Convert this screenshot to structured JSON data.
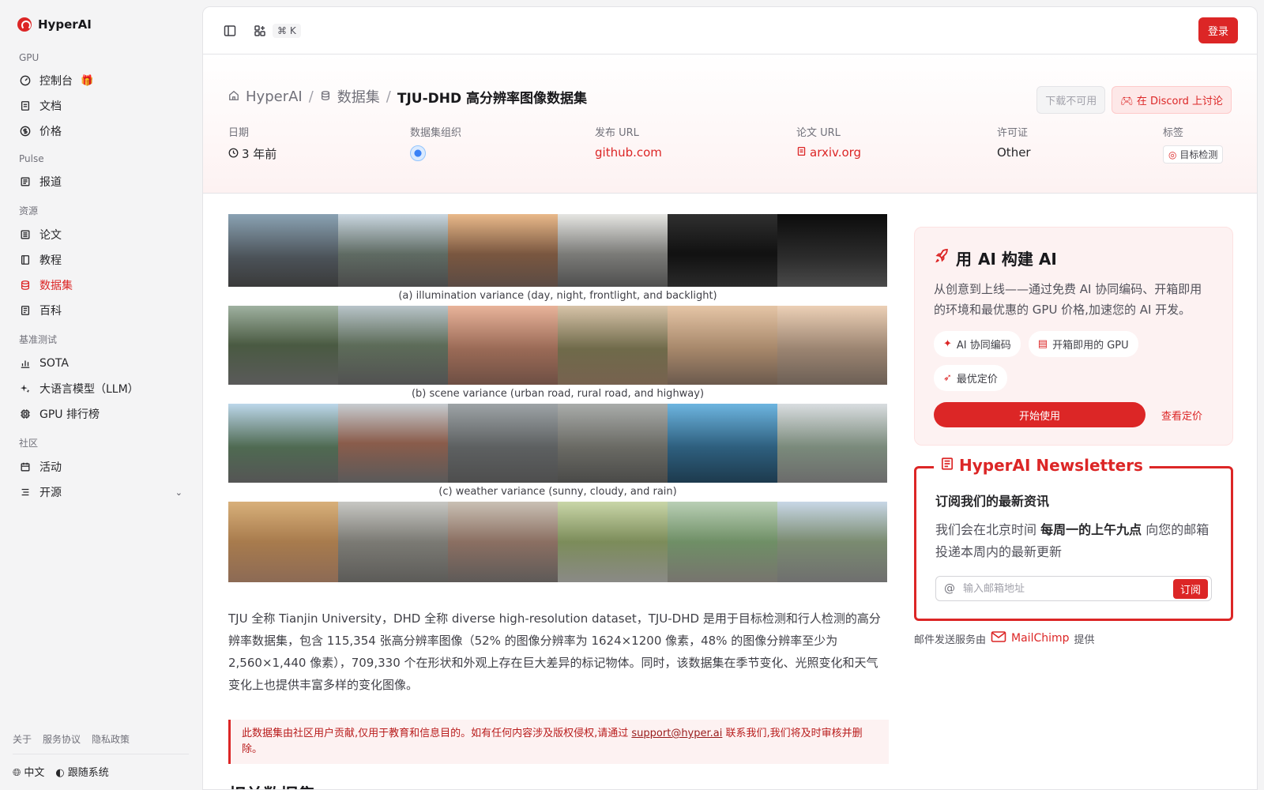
{
  "brand": {
    "name": "HyperAI"
  },
  "sidebar": {
    "sections": {
      "gpu": "GPU",
      "pulse": "Pulse",
      "resources": "资源",
      "benchmark": "基准测试",
      "community": "社区"
    },
    "items": {
      "console": "控制台",
      "docs": "文档",
      "pricing": "价格",
      "news": "报道",
      "papers": "论文",
      "tutorials": "教程",
      "datasets": "数据集",
      "wiki": "百科",
      "sota": "SOTA",
      "llm": "大语言模型（LLM）",
      "gpu_rank": "GPU 排行榜",
      "events": "活动",
      "opensource": "开源"
    },
    "active": "datasets",
    "footer": {
      "about": "关于",
      "terms": "服务协议",
      "privacy": "隐私政策",
      "language": "中文",
      "theme": "跟随系统"
    }
  },
  "topbar": {
    "shortcut": "⌘ K",
    "login": "登录"
  },
  "header": {
    "breadcrumb": {
      "home": "HyperAI",
      "section": "数据集",
      "current": "TJU-DHD 高分辨率图像数据集"
    },
    "download_label": "下载不可用",
    "discord_label": "在 Discord 上讨论",
    "meta": {
      "date_label": "日期",
      "date_value": "3 年前",
      "org_label": "数据集组织",
      "release_label": "发布 URL",
      "release_value": "github.com",
      "paper_label": "论文 URL",
      "paper_value": "arxiv.org",
      "license_label": "许可证",
      "license_value": "Other",
      "tags_label": "标签",
      "tag_value": "目标检测"
    }
  },
  "figure": {
    "captions": [
      "(a)  illumination variance (day, night, frontlight, and backlight)",
      "(b)  scene variance (urban road, rural road, and highway)",
      "(c)  weather variance (sunny, cloudy, and rain)"
    ]
  },
  "description": "TJU 全称 Tianjin University，DHD 全称 diverse high-resolution dataset，TJU-DHD 是用于目标检测和行人检测的高分辨率数据集，包含 115,354 张高分辨率图像（52% 的图像分辨率为 1624×1200 像素，48% 的图像分辨率至少为 2,560×1,440 像素），709,330 个在形状和外观上存在巨大差异的标记物体。同时，该数据集在季节变化、光照变化和天气变化上也提供丰富多样的变化图像。",
  "notice": {
    "before": "此数据集由社区用户贡献,仅用于教育和信息目的。如有任何内容涉及版权侵权,请通过 ",
    "email": "support@hyper.ai",
    "after": " 联系我们,我们将及时审核并删除。"
  },
  "related_title": "相关数据集",
  "promo": {
    "title_prefix": "用 ",
    "title_bold": "AI 构建 AI",
    "description": "从创意到上线——通过免费 AI 协同编码、开箱即用的环境和最优惠的 GPU 价格,加速您的 AI 开发。",
    "chips": [
      "AI 协同编码",
      "开箱即用的 GPU",
      "最优定价"
    ],
    "start": "开始使用",
    "pricing": "查看定价"
  },
  "newsletter": {
    "legend": "HyperAI Newsletters",
    "title": "订阅我们的最新资讯",
    "desc_before": "我们会在北京时间 ",
    "desc_bold": "每周一的上午九点",
    "desc_after": " 向您的邮箱投递本周内的最新更新",
    "placeholder": "输入邮箱地址",
    "subscribe": "订阅",
    "powered_before": "邮件发送服务由",
    "powered_brand": "MailChimp",
    "powered_after": "提供"
  },
  "colors": {
    "accent": "#dc2626",
    "accent_soft": "#fdf2f2"
  },
  "icons": {
    "sidebar_toggle": "sidebar-toggle-icon",
    "apps": "apps-icon",
    "home": "home-icon",
    "database": "database-icon",
    "clock": "clock-icon",
    "file": "file-icon",
    "discord": "discord-icon",
    "rocket": "rocket-icon",
    "mail": "mail-icon"
  }
}
